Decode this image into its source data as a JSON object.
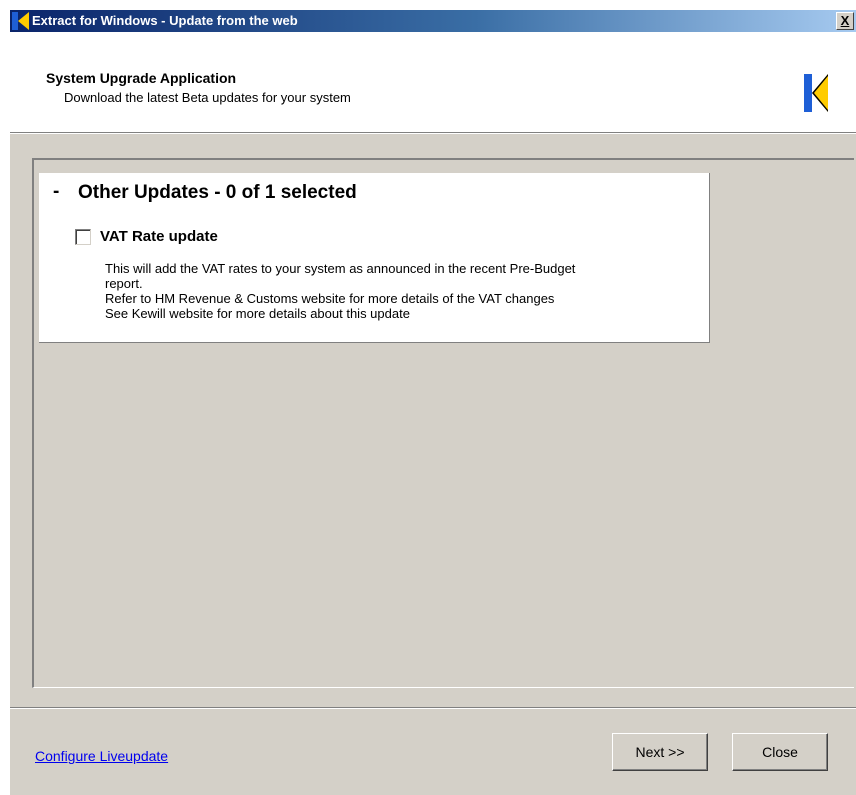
{
  "window": {
    "title": "Extract for Windows - Update from the web",
    "close_label": "X"
  },
  "header": {
    "title": "System Upgrade Application",
    "subtitle": "Download the latest Beta updates for your system"
  },
  "group": {
    "toggle_symbol": "-",
    "title": "Other Updates - 0 of 1 selected",
    "items": [
      {
        "label": "VAT Rate update",
        "checked": false,
        "description": [
          "This will add the VAT rates to your system as announced in the recent Pre-Budget",
          "report.",
          "Refer to HM Revenue & Customs website for more details of the VAT changes",
          "See Kewill website for more details about this update"
        ]
      }
    ]
  },
  "footer": {
    "configure_link": "Configure Liveupdate",
    "next_label": "Next >>",
    "close_label": "Close"
  },
  "colors": {
    "logo_blue": "#1e5fd6",
    "logo_yellow": "#ffcc00",
    "face": "#d4d0c8"
  },
  "icons": {
    "title_logo": "kewill-logo-icon",
    "header_logo": "kewill-logo-icon"
  }
}
